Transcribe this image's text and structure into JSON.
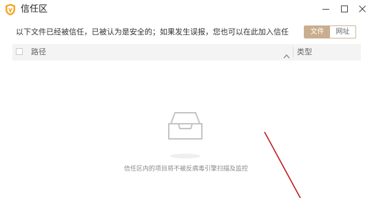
{
  "window": {
    "title": "信任区",
    "minimize_icon": "minimize-icon",
    "maximize_icon": "maximize-icon",
    "close_icon": "close-icon"
  },
  "notice": {
    "text": "以下文件已经被信任，已被认为是安全的；如果发生误报，您也可以在此加入信任"
  },
  "view_toggle": {
    "file_label": "文件",
    "url_label": "网址",
    "selected": "文件",
    "active_color": "#c9ad8e"
  },
  "table": {
    "columns": [
      "路径",
      "类型"
    ],
    "rows": []
  },
  "empty_state": {
    "icon": "empty-tray-icon",
    "message": "信任区内的项目将不被反病毒引擎扫描及监控"
  },
  "colors": {
    "accent": "#c9ad8e",
    "annotation": "#c0181b"
  }
}
